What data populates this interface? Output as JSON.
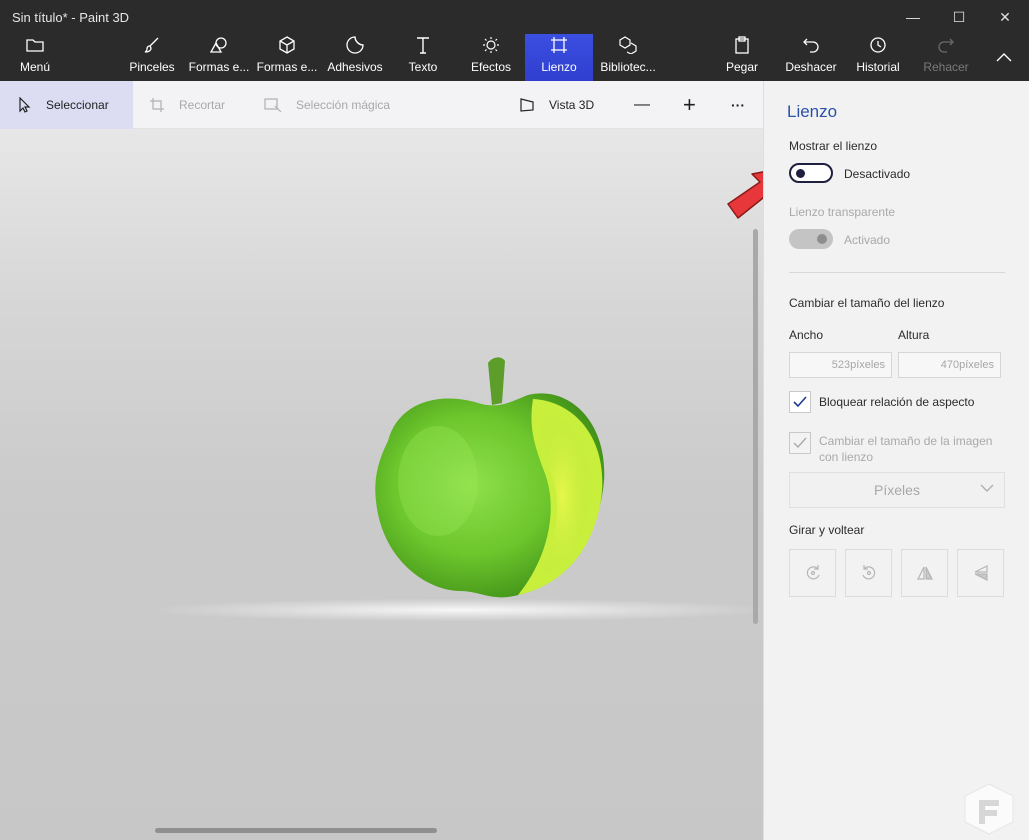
{
  "window": {
    "title": "Sin título* - Paint 3D",
    "minimize": "—",
    "maximize": "☐",
    "close": "✕"
  },
  "ribbon": {
    "menu": "Menú",
    "pinceles": "Pinceles",
    "formas2d": "Formas e...",
    "formas3d": "Formas e...",
    "adhesivos": "Adhesivos",
    "texto": "Texto",
    "efectos": "Efectos",
    "lienzo": "Lienzo",
    "biblioteca": "Bibliotec...",
    "pegar": "Pegar",
    "deshacer": "Deshacer",
    "historial": "Historial",
    "rehacer": "Rehacer",
    "active_tab": "Lienzo"
  },
  "toolbar": {
    "seleccionar": "Seleccionar",
    "recortar": "Recortar",
    "seleccion_magica": "Selección mágica",
    "vista3d": "Vista 3D",
    "zoom_out": "—",
    "zoom_in": "+",
    "more": "···"
  },
  "panel": {
    "title": "Lienzo",
    "mostrar_label": "Mostrar el lienzo",
    "mostrar_state": "Desactivado",
    "transparente_label": "Lienzo transparente",
    "transparente_state": "Activado",
    "resize_heading": "Cambiar el tamaño del lienzo",
    "ancho_label": "Ancho",
    "altura_label": "Altura",
    "ancho_value": "523píxeles",
    "altura_value": "470píxeles",
    "lock_aspect": "Bloquear relación de aspecto",
    "resize_image": "Cambiar el tamaño de la imagen con lienzo",
    "units": "Píxeles",
    "rotate_heading": "Girar y voltear"
  },
  "colors": {
    "accent": "#2f3fd0",
    "panel_title": "#2b52a8",
    "arrow": "#e8373b",
    "apple": "#7bd13a"
  }
}
